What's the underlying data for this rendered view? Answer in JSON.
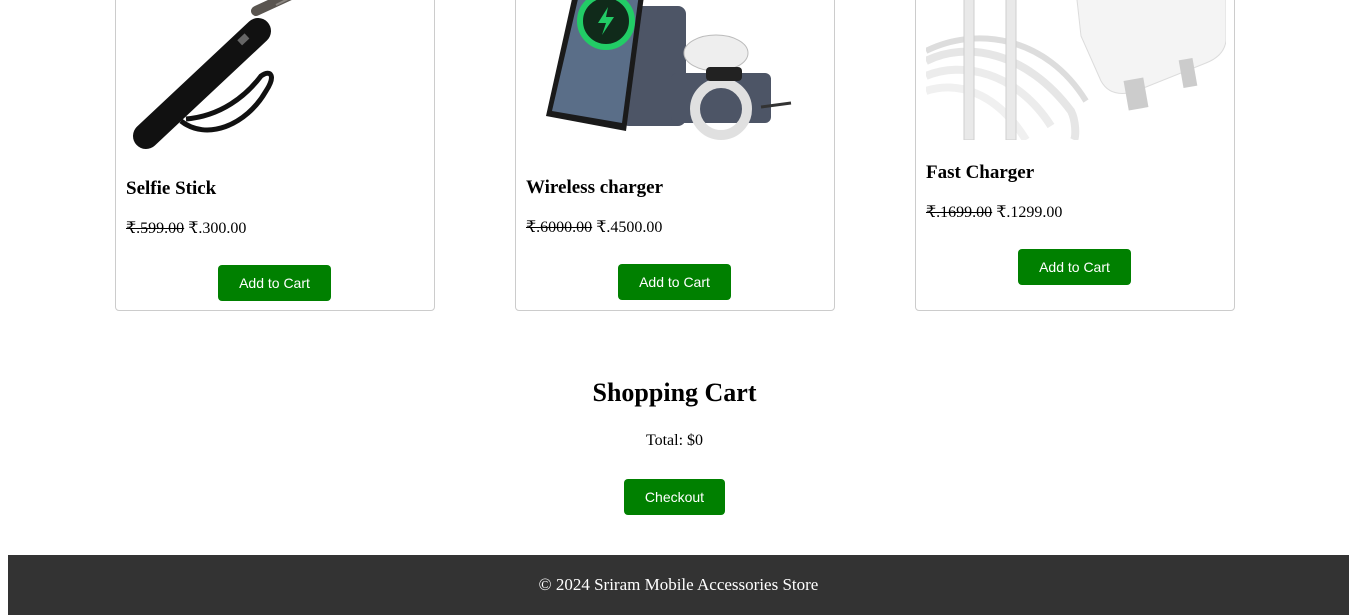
{
  "products": [
    {
      "name": "Selfie Stick",
      "old_price": "₹.599.00",
      "price": "₹.300.00",
      "button": "Add to Cart",
      "image_icon": "selfie-stick-image"
    },
    {
      "name": "Wireless charger",
      "old_price": "₹.6000.00",
      "price": "₹.4500.00",
      "button": "Add to Cart",
      "image_icon": "wireless-charger-image"
    },
    {
      "name": "Fast Charger",
      "old_price": "₹.1699.00",
      "price": "₹.1299.00",
      "button": "Add to Cart",
      "image_icon": "fast-charger-image"
    }
  ],
  "cart": {
    "title": "Shopping Cart",
    "total": "Total: $0",
    "checkout": "Checkout"
  },
  "footer": {
    "text": "© 2024 Sriram Mobile Accessories Store"
  },
  "colors": {
    "button": "#008000",
    "footer_bg": "#333333",
    "card_border": "#cccccc"
  }
}
